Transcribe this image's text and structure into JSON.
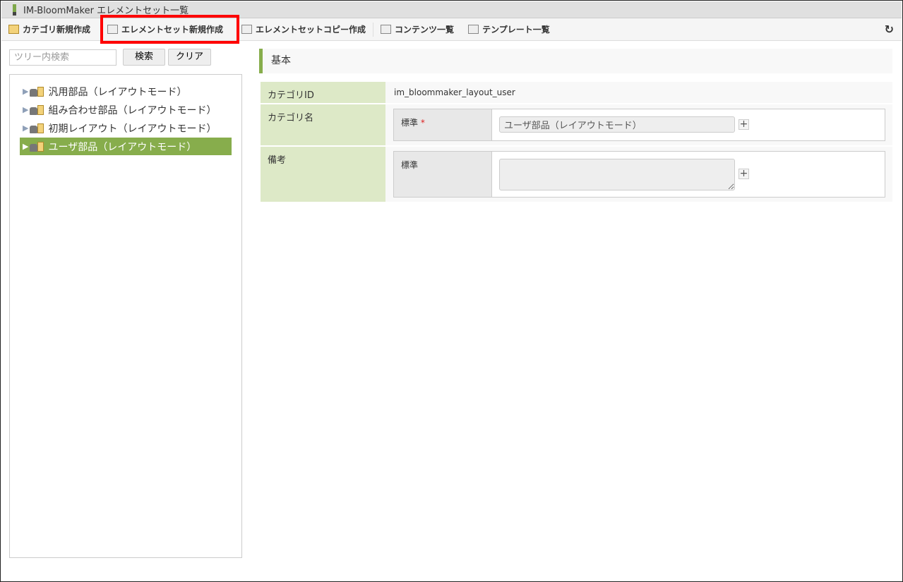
{
  "window": {
    "title": "IM-BloomMaker エレメントセット一覧"
  },
  "toolbar": {
    "items": [
      "カテゴリ新規作成",
      "エレメントセット新規作成",
      "エレメントセットコピー作成",
      "コンテンツ一覧",
      "テンプレート一覧"
    ],
    "refresh_icon": "↻"
  },
  "tree": {
    "search_placeholder": "ツリー内検索",
    "search_button": "検索",
    "clear_button": "クリア",
    "nodes": [
      "汎用部品（レイアウトモード）",
      "組み合わせ部品（レイアウトモード）",
      "初期レイアウト（レイアウトモード）",
      "ユーザ部品（レイアウトモード）"
    ],
    "selected_index": 3
  },
  "detail": {
    "section_title": "基本",
    "category_id_label": "カテゴリID",
    "category_id": "im_bloommaker_layout_user",
    "category_name_label": "カテゴリ名",
    "locale_label": "標準",
    "required_mark": "*",
    "category_name": "ユーザ部品（レイアウトモード）",
    "remarks_label": "備考",
    "remarks_locale_label": "標準",
    "remarks": "",
    "plus": "+"
  },
  "colors": {
    "accent": "#87ad4c",
    "label_bg": "#dde9c7",
    "highlight": "#ff0000"
  }
}
